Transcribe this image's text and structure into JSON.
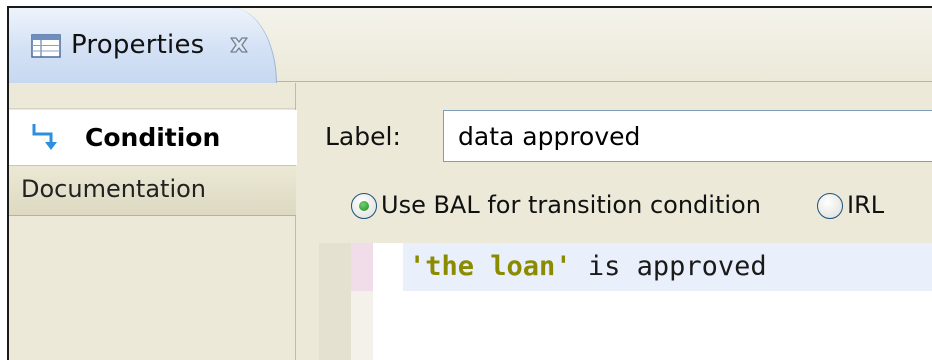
{
  "view": {
    "tab_title": "Properties",
    "tab_icon": "properties-table-icon",
    "close_icon": "close-x-icon"
  },
  "sidenav": {
    "items": [
      {
        "label": "Condition",
        "icon": "transition-arrow-icon",
        "selected": true
      },
      {
        "label": "Documentation",
        "selected": false
      }
    ]
  },
  "form": {
    "label_caption": "Label:",
    "label_value": "data approved",
    "radios": [
      {
        "label": "Use BAL for transition condition",
        "selected": true
      },
      {
        "label": "IRL",
        "selected": false
      }
    ]
  },
  "editor": {
    "string_token": "'the loan'",
    "rest_text": " is approved"
  },
  "colors": {
    "tab_gradient_bottom": "#c6d8f1",
    "panel_bg": "#ece9d8",
    "string_color": "#8b8b00",
    "current_line": "#e9f0fb"
  }
}
